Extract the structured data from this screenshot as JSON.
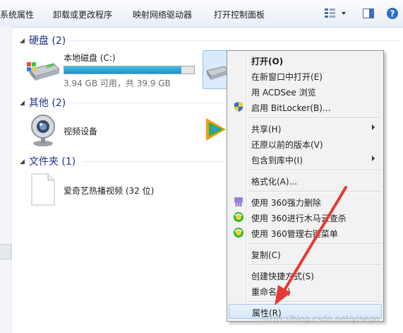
{
  "toolbar": {
    "items": [
      "系统属性",
      "卸载或更改程序",
      "映射网络驱动器",
      "打开控制面板"
    ]
  },
  "groups": {
    "drives": {
      "header": "硬盘 (2)"
    },
    "other": {
      "header": "其他 (2)"
    },
    "folders": {
      "header": "文件夹 (1)"
    }
  },
  "drive_c": {
    "name": "本地磁盘 (C:)",
    "info": "3.94 GB 可用，共 39.9 GB",
    "used_fraction": 0.9
  },
  "video_device": {
    "label": "视频设备"
  },
  "folder_item": {
    "label": "爱奇艺热播视频 (32 位)"
  },
  "context_menu": {
    "open": "打开(O)",
    "open_new_window": "在新窗口中打开(E)",
    "acdsee": "用 ACDSee 浏览",
    "bitlocker": "启用 BitLocker(B)...",
    "share": "共享(H)",
    "restore": "还原以前的版本(V)",
    "include_library": "包含到库中(I)",
    "format": "格式化(A)...",
    "shred_360": "使用 360强力删除",
    "trojan_360": "使用 360进行木马云查杀",
    "rightmenu_360": "使用 360管理右键菜单",
    "copy": "复制(C)",
    "create_shortcut": "创建快捷方式(S)",
    "rename": "重命名(M)",
    "properties": "属性(R)"
  },
  "watermark": "https://blog.csdn.net/yisego",
  "colors": {
    "accent": "#1e3287",
    "annotation": "#e53935",
    "bar_fill": "#26a0da"
  }
}
